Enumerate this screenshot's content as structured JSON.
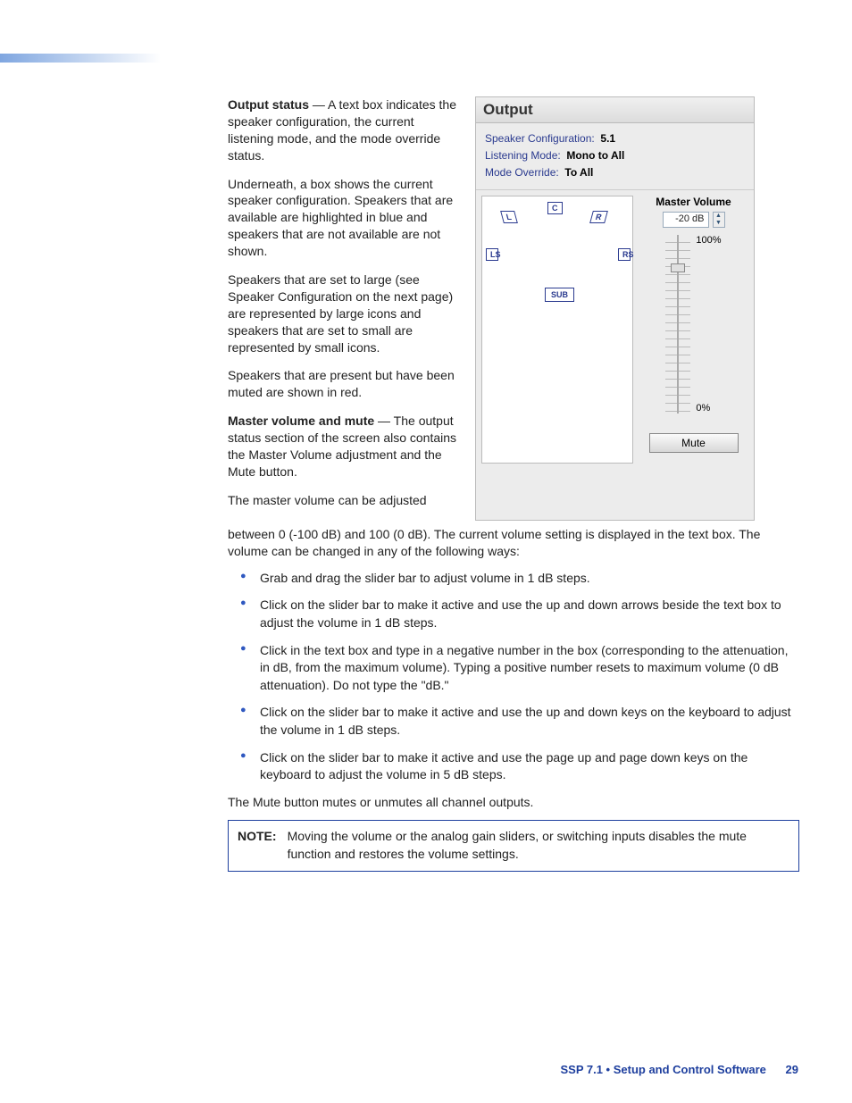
{
  "intro": {
    "p1_bold": "Output status",
    "p1_rest": " — A text box indicates the speaker configuration, the current listening mode, and the mode override status.",
    "p2": "Underneath, a box shows the current speaker configuration. Speakers that are available are highlighted in blue and speakers that are not available are not shown.",
    "p3": "Speakers that are set to large (see Speaker Configuration on the next page) are represented by large icons and speakers that are set to small are represented by small icons.",
    "p4": "Speakers that are present but have been muted are shown in red.",
    "p5_bold": "Master volume and mute",
    "p5_rest": " — The output status section of the screen also contains the Master Volume adjustment and the Mute button.",
    "p6": "The master volume can be adjusted"
  },
  "panel": {
    "title": "Output",
    "status": {
      "spk_label": "Speaker Configuration:",
      "spk_value": "5.1",
      "lm_label": "Listening Mode:",
      "lm_value": "Mono to All",
      "mo_label": "Mode Override:",
      "mo_value": "To All"
    },
    "speakers": {
      "L": "L",
      "C": "C",
      "R": "R",
      "LS": "LS",
      "RS": "RS",
      "SUB": "SUB"
    },
    "mv": {
      "title": "Master Volume",
      "value": "-20 dB",
      "max": "100%",
      "min": "0%",
      "mute": "Mute"
    }
  },
  "after": {
    "p7_rest": "between 0 (-100 dB) and 100 (0 dB). The current volume setting is displayed in the text box. The volume can be changed in any of the following ways:",
    "bullets": [
      "Grab and drag the slider bar to adjust volume in 1 dB steps.",
      "Click on the slider bar to make it active and use the up and down arrows beside the text box to adjust the volume in 1 dB steps.",
      "Click in the text box and type in a negative number in the box (corresponding to the attenuation, in dB, from the maximum volume). Typing a positive number resets to maximum volume (0 dB attenuation). Do not type the \"dB.\"",
      "Click on the slider bar to make it active and use the up and down keys on the keyboard to adjust the volume in 1 dB steps.",
      "Click on the slider bar to make it active and use the page up and page down keys on the keyboard to adjust the volume in 5 dB steps."
    ],
    "p8": "The Mute button mutes or unmutes all channel outputs."
  },
  "note": {
    "label": "NOTE:",
    "text": "Moving the volume or the analog gain sliders, or switching inputs disables the mute function and restores the volume settings."
  },
  "footer": {
    "text": "SSP 7.1 • Setup and Control Software",
    "page": "29"
  }
}
